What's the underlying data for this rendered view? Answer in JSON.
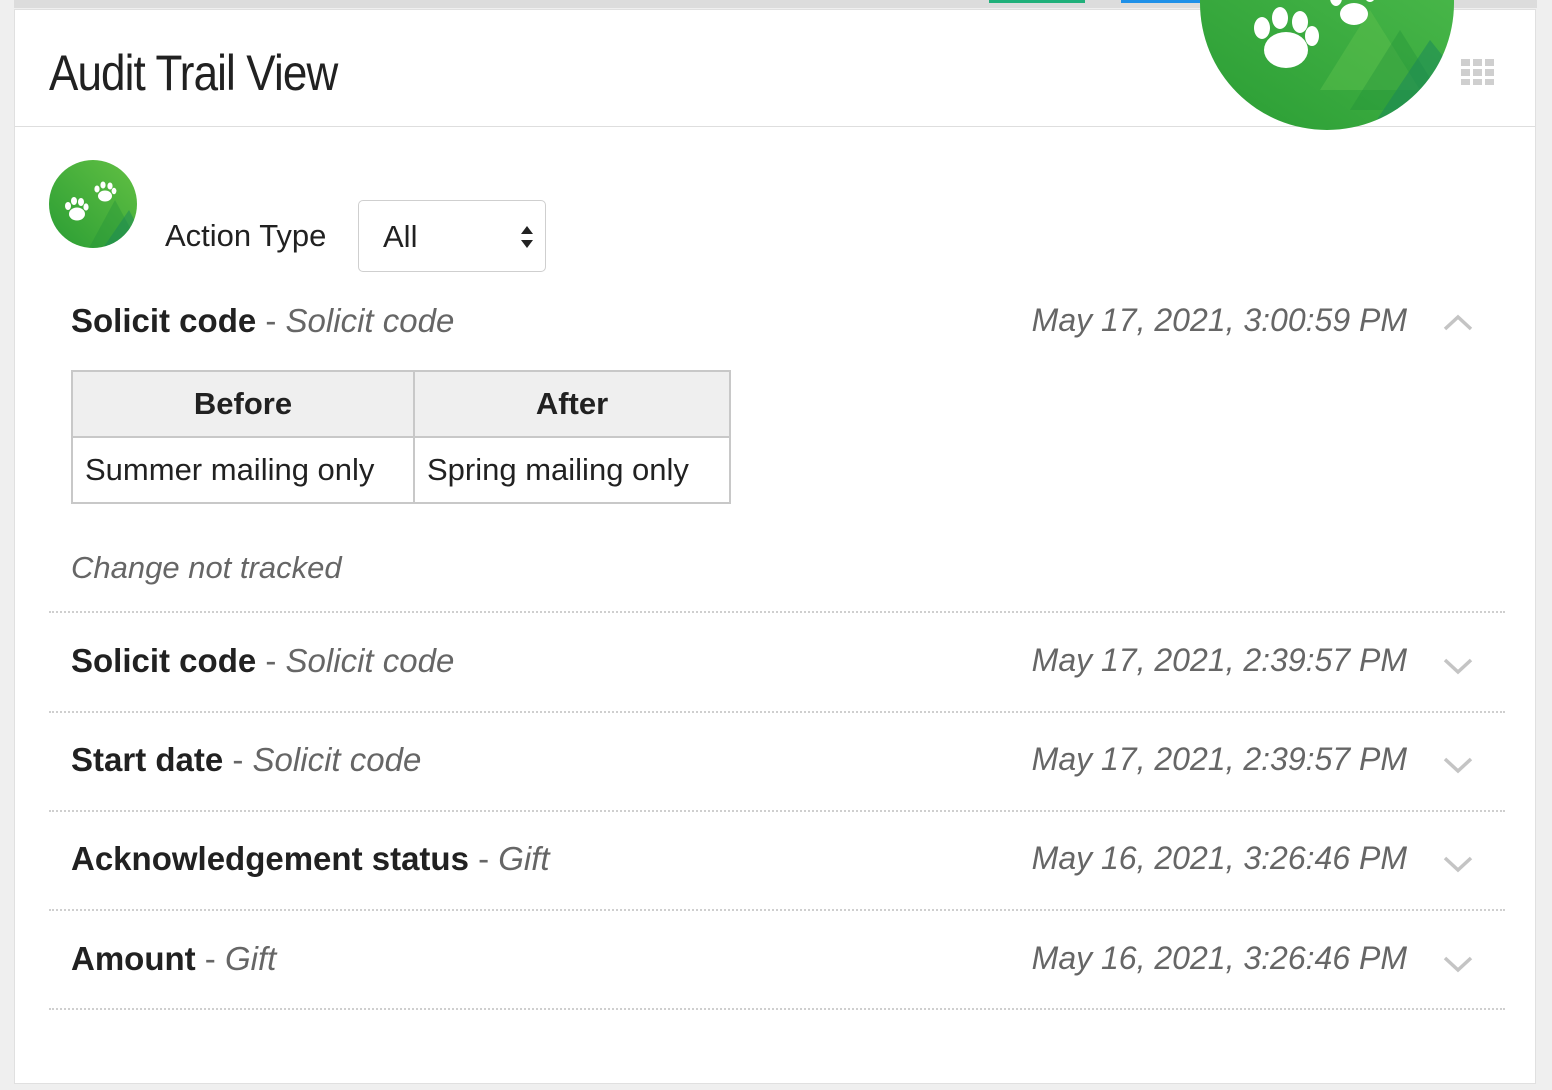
{
  "header": {
    "title": "Audit Trail View",
    "logo_icon": "paw-logo-icon",
    "apps_icon": "grid-icon"
  },
  "filter": {
    "label": "Action Type",
    "selected": "All"
  },
  "expanded_entry": {
    "field": "Solicit code",
    "type": "Solicit code",
    "timestamp": "May 17, 2021, 3:00:59 PM",
    "state": "expanded",
    "table": {
      "headers": [
        "Before",
        "After"
      ],
      "rows": [
        [
          "Summer mailing only",
          "Spring mailing only"
        ]
      ]
    },
    "note": "Change not tracked"
  },
  "entries": [
    {
      "field": "Solicit code",
      "type": "Solicit code",
      "timestamp": "May 17, 2021, 2:39:57 PM",
      "state": "collapsed"
    },
    {
      "field": "Start date",
      "type": "Solicit code",
      "timestamp": "May 17, 2021, 2:39:57 PM",
      "state": "collapsed"
    },
    {
      "field": "Acknowledgement status",
      "type": "Gift",
      "timestamp": "May 16, 2021, 3:26:46 PM",
      "state": "collapsed"
    },
    {
      "field": "Amount",
      "type": "Gift",
      "timestamp": "May 16, 2021, 3:26:46 PM",
      "state": "collapsed"
    }
  ],
  "separator": " - ",
  "colors": {
    "logo_green_dark": "#1a9a3a",
    "logo_green_light": "#6cc53a",
    "text_primary": "#212121",
    "text_secondary": "#666666"
  }
}
